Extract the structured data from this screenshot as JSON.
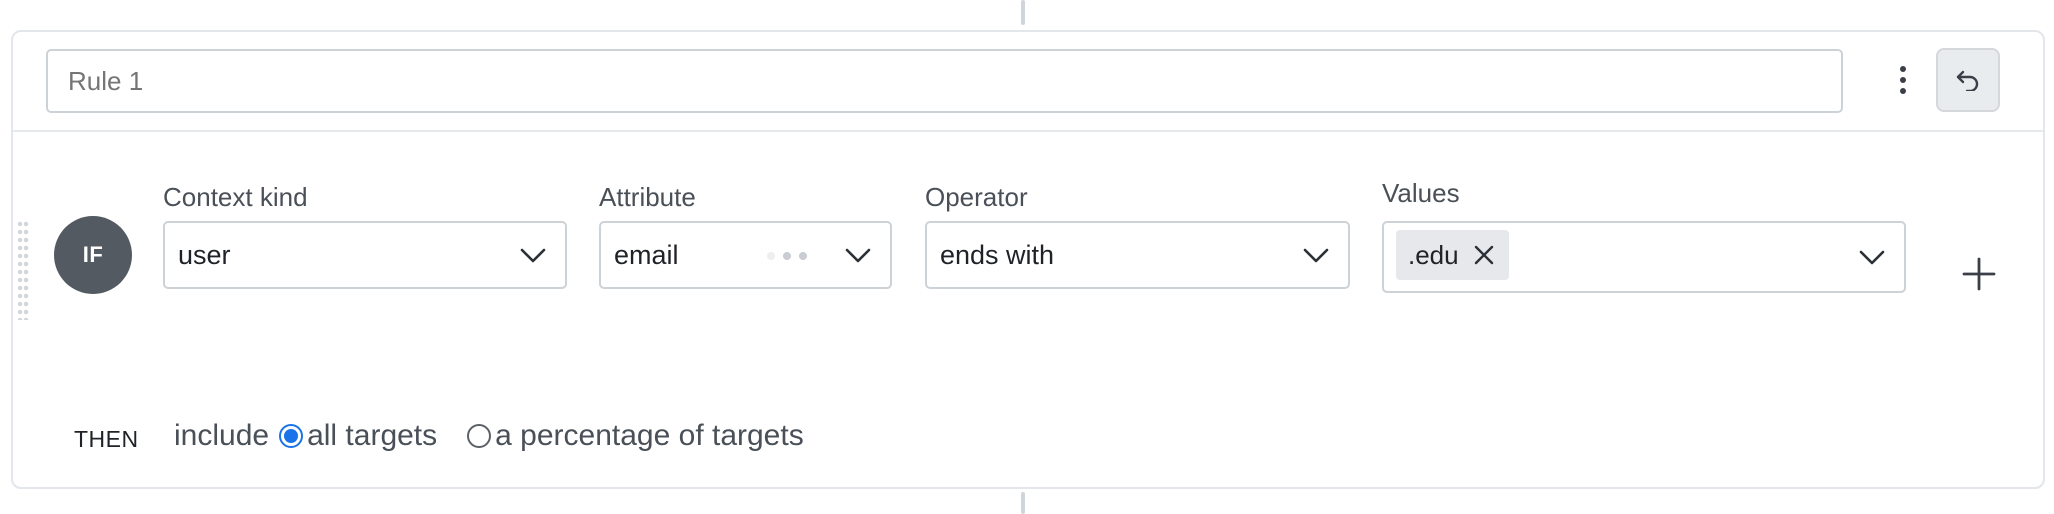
{
  "rule": {
    "name_placeholder": "Rule 1",
    "menu_icon": "kebab-vertical-icon",
    "undo_icon": "undo-icon"
  },
  "clause": {
    "badge": "IF",
    "context_kind": {
      "label": "Context kind",
      "value": "user"
    },
    "attribute": {
      "label": "Attribute",
      "value": "email"
    },
    "operator": {
      "label": "Operator",
      "value": "ends with"
    },
    "values": {
      "label": "Values",
      "chips": [
        ".edu"
      ]
    },
    "add_icon": "plus-icon"
  },
  "then": {
    "label": "THEN",
    "action": "include",
    "options": [
      {
        "label": "all targets",
        "selected": true
      },
      {
        "label": "a percentage of targets",
        "selected": false
      }
    ]
  },
  "colors": {
    "accent": "#1a73e8",
    "badge": "#545a62"
  }
}
